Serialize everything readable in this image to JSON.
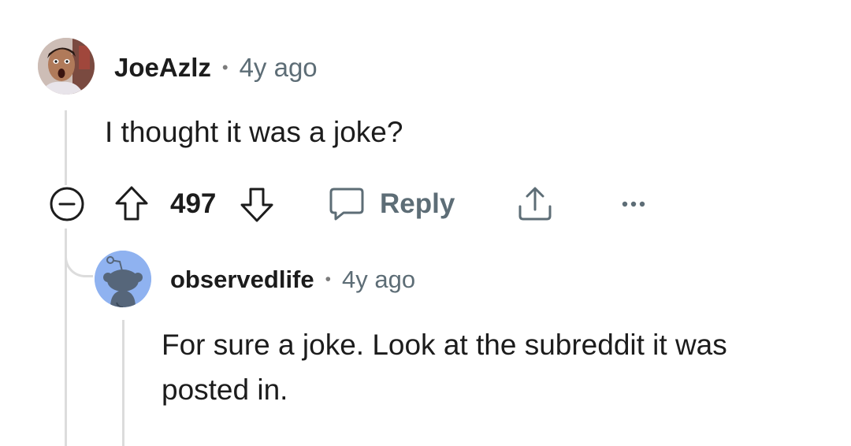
{
  "comments": [
    {
      "username": "JoeAzlz",
      "separator": "•",
      "age": "4y ago",
      "body": "I thought it was a joke?",
      "avatar_icon": "user-photo-avatar",
      "actions": {
        "collapse_icon": "collapse-minus-icon",
        "upvote_icon": "upvote-arrow-icon",
        "vote_count": "497",
        "downvote_icon": "downvote-arrow-icon",
        "reply_icon": "speech-bubble-icon",
        "reply_label": "Reply",
        "share_icon": "share-upload-icon",
        "more_icon": "more-dots-icon"
      }
    },
    {
      "username": "observedlife",
      "separator": "•",
      "age": "4y ago",
      "body_line1": "For sure a joke. Look at the subreddit it was",
      "body_line2": "posted in.",
      "avatar_icon": "snoo-default-avatar"
    }
  ],
  "colors": {
    "text": "#1c1c1c",
    "meta": "#5d6d76",
    "thread_line": "#dcdcdc",
    "snoo_bg": "#8fb2f0"
  }
}
